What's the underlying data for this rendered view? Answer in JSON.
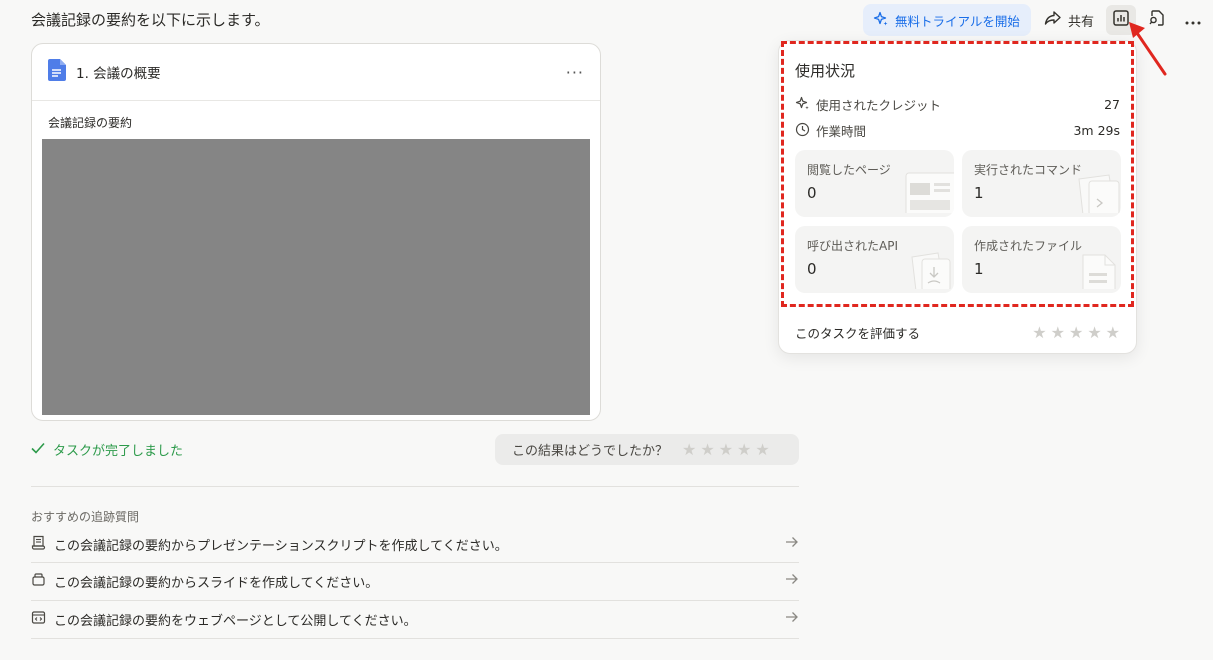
{
  "header": {
    "message": "会議記録の要約を以下に示します。",
    "trial_label": "無料トライアルを開始",
    "share_label": "共有"
  },
  "card": {
    "title": "1. 会議の概要",
    "more_label": "···",
    "subtitle": "会議記録の要約"
  },
  "status": {
    "done_label": "タスクが完了しました",
    "rate_prompt": "この結果はどうでしたか？"
  },
  "followups": {
    "title": "おすすめの追跡質問",
    "items": [
      {
        "label": "この会議記録の要約からプレゼンテーションスクリプトを作成してください。",
        "icon": "script-icon"
      },
      {
        "label": "この会議記録の要約からスライドを作成してください。",
        "icon": "slides-icon"
      },
      {
        "label": "この会議記録の要約をウェブページとして公開してください。",
        "icon": "webpage-icon"
      }
    ]
  },
  "usage": {
    "title": "使用状況",
    "credits_label": "使用されたクレジット",
    "credits_value": "27",
    "time_label": "作業時間",
    "time_value": "3m 29s",
    "tiles": [
      {
        "label": "閲覧したページ",
        "value": "0"
      },
      {
        "label": "実行されたコマンド",
        "value": "1"
      },
      {
        "label": "呼び出されたAPI",
        "value": "0"
      },
      {
        "label": "作成されたファイル",
        "value": "1"
      }
    ],
    "rate_label": "このタスクを評価する"
  },
  "colors": {
    "accent": "#1a6ee8",
    "success": "#2c9a4a",
    "highlight": "#e0271f"
  }
}
